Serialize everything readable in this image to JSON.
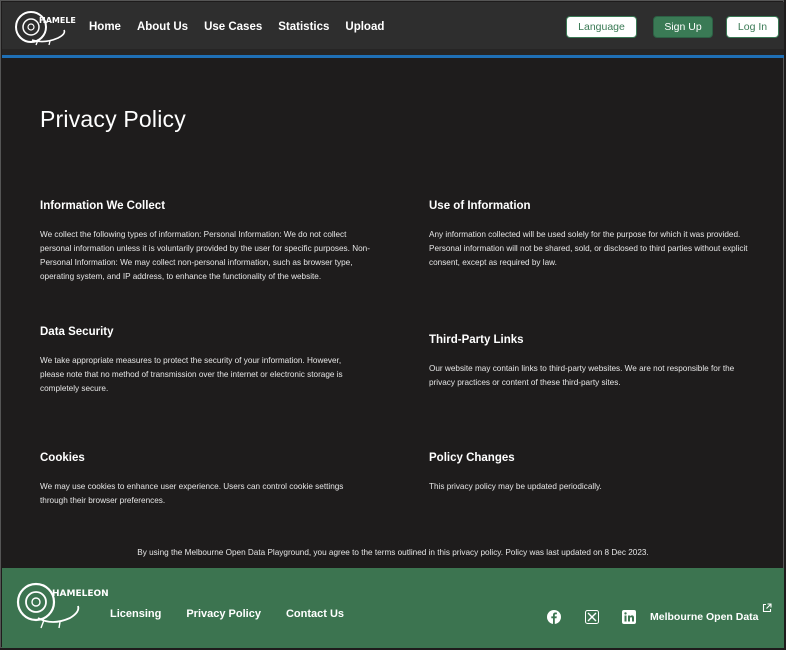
{
  "header": {
    "logo_text": "HAMELEON",
    "nav": [
      "Home",
      "About Us",
      "Use Cases",
      "Statistics",
      "Upload"
    ],
    "language_label": "Language",
    "signup_label": "Sign Up",
    "login_label": "Log In"
  },
  "page": {
    "title": "Privacy Policy",
    "sections": [
      {
        "heading": "Information We Collect",
        "body": "We collect the following types of information: Personal Information: We do not collect personal information unless it is voluntarily provided by the user for specific purposes. Non-Personal Information: We may collect non-personal information, such as browser type, operating system, and IP address, to enhance the functionality of the website."
      },
      {
        "heading": "Use of Information",
        "body": "Any information collected will be used solely for the purpose for which it was provided. Personal information will not be shared, sold, or disclosed to third parties without explicit consent, except as required by law."
      },
      {
        "heading": "Data Security",
        "body": "We take appropriate measures to protect the security of your information. However, please note that no method of transmission over the internet or electronic storage is completely secure."
      },
      {
        "heading": "Third-Party Links",
        "body": "Our website may contain links to third-party websites. We are not responsible for the privacy practices or content of these third-party sites."
      },
      {
        "heading": "Cookies",
        "body": "We may use cookies to enhance user experience. Users can control cookie settings through their browser preferences."
      },
      {
        "heading": "Policy Changes",
        "body": "This privacy policy may be updated periodically."
      }
    ],
    "footnote": "By using the Melbourne Open Data Playground, you agree to the terms outlined in this privacy policy. Policy was last updated on 8 Dec 2023."
  },
  "footer": {
    "logo_text": "HAMELEON",
    "links": [
      "Licensing",
      "Privacy Policy",
      "Contact Us"
    ],
    "social_icons": [
      "facebook-icon",
      "x-icon",
      "linkedin-icon"
    ],
    "mod_link": "Melbourne Open Data",
    "colors": {
      "footer_bg": "#3c7450",
      "accent": "#3a7a55",
      "header_line": "#1f6fb5"
    }
  }
}
